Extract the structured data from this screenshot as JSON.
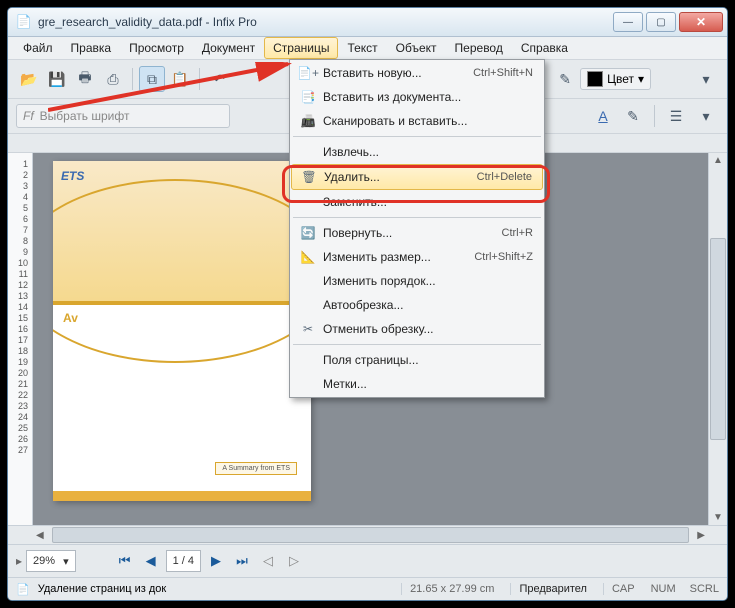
{
  "title": "gre_research_validity_data.pdf - Infix Pro",
  "menubar": [
    "Файл",
    "Правка",
    "Просмотр",
    "Документ",
    "Страницы",
    "Текст",
    "Объект",
    "Перевод",
    "Справка"
  ],
  "open_menu_index": 4,
  "dropdown": [
    {
      "icon": "📄+",
      "label": "Вставить новую...",
      "shortcut": "Ctrl+Shift+N"
    },
    {
      "icon": "📑",
      "label": "Вставить из документа..."
    },
    {
      "icon": "📠",
      "label": "Сканировать и вставить..."
    },
    {
      "sep": true
    },
    {
      "icon": "",
      "label": "Извлечь..."
    },
    {
      "icon": "🗑",
      "label": "Удалить...",
      "shortcut": "Ctrl+Delete",
      "hl": true
    },
    {
      "icon": "",
      "label": "Заменить..."
    },
    {
      "sep": true
    },
    {
      "icon": "🔄",
      "label": "Повернуть...",
      "shortcut": "Ctrl+R"
    },
    {
      "icon": "📐",
      "label": "Изменить размер...",
      "shortcut": "Ctrl+Shift+Z"
    },
    {
      "icon": "",
      "label": "Изменить порядок..."
    },
    {
      "icon": "",
      "label": "Автообрезка..."
    },
    {
      "icon": "✂",
      "label": "Отменить обрезку..."
    },
    {
      "sep": true
    },
    {
      "icon": "",
      "label": "Поля страницы..."
    },
    {
      "icon": "",
      "label": "Метки..."
    }
  ],
  "fontbar": {
    "placeholder": "Выбрать шрифт",
    "color_label": "Цвет"
  },
  "page_tab": "1",
  "ruler": [
    "1",
    "2",
    "3",
    "4",
    "5",
    "6",
    "7",
    "8",
    "9",
    "10",
    "11",
    "12",
    "13",
    "14",
    "15",
    "16",
    "17",
    "18",
    "19",
    "20",
    "21",
    "22",
    "23",
    "24",
    "25",
    "26",
    "27"
  ],
  "doc": {
    "logo": "ETS",
    "badge": "Av",
    "summary": "A Summary from ETS"
  },
  "nav": {
    "zoom": "29%",
    "page": "1 / 4"
  },
  "status": {
    "msg": "Удаление страниц из док",
    "dims": "21.65 x 27.99 cm",
    "preview": "Предварител",
    "caps": "CAP",
    "num": "NUM",
    "scrl": "SCRL"
  }
}
